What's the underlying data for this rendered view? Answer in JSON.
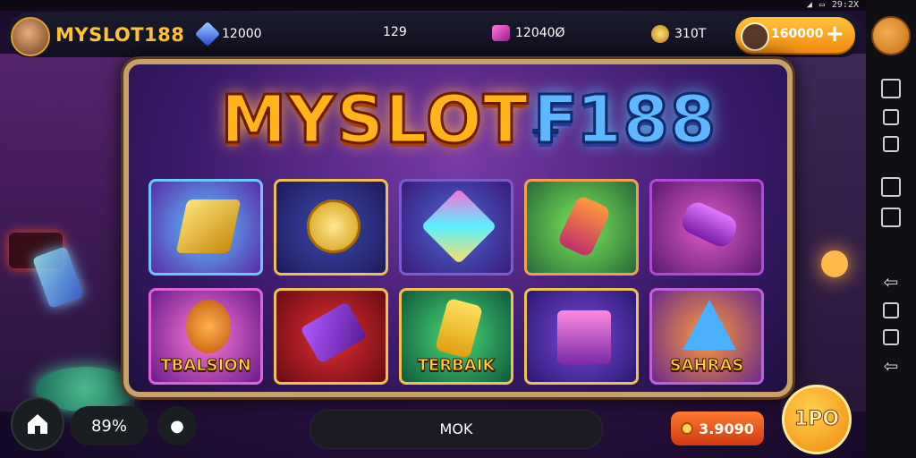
{
  "status": {
    "right_text": "29:2X"
  },
  "topbar": {
    "brand": "MYSLOT188",
    "currencies": [
      {
        "icon": "blue-gem-icon",
        "value": "12000"
      },
      {
        "icon": "none",
        "value": "129"
      },
      {
        "icon": "pink-gem-icon",
        "value": "12040Ø"
      },
      {
        "icon": "gold-trophy-icon",
        "value": "310T"
      }
    ],
    "buy_value": "160000",
    "buy_plus": "+"
  },
  "board": {
    "logo_main": "MYSLOT",
    "logo_tail": "₣188",
    "tiles": [
      {
        "symbol": "gold-bars",
        "label": ""
      },
      {
        "symbol": "gold-coins",
        "label": ""
      },
      {
        "symbol": "rainbow-prism",
        "label": ""
      },
      {
        "symbol": "phone-device",
        "label": ""
      },
      {
        "symbol": "purple-tube",
        "label": ""
      },
      {
        "symbol": "bear-mascot",
        "label": "TBALSION"
      },
      {
        "symbol": "purple-book-coin",
        "label": ""
      },
      {
        "symbol": "yellow-device",
        "label": "TERBAIK"
      },
      {
        "symbol": "treasure-chest",
        "label": ""
      },
      {
        "symbol": "blue-wedge",
        "label": "SAHRAS"
      }
    ]
  },
  "bottom": {
    "home_icon": "house-icon",
    "stat_pill": "89%",
    "center_label": "MOK",
    "balance": "3.9090",
    "spin_label": "1PO"
  },
  "colors": {
    "accent_gold": "#ffb51a",
    "accent_blue": "#5fb8ff",
    "buy_orange": "#f08a10"
  }
}
